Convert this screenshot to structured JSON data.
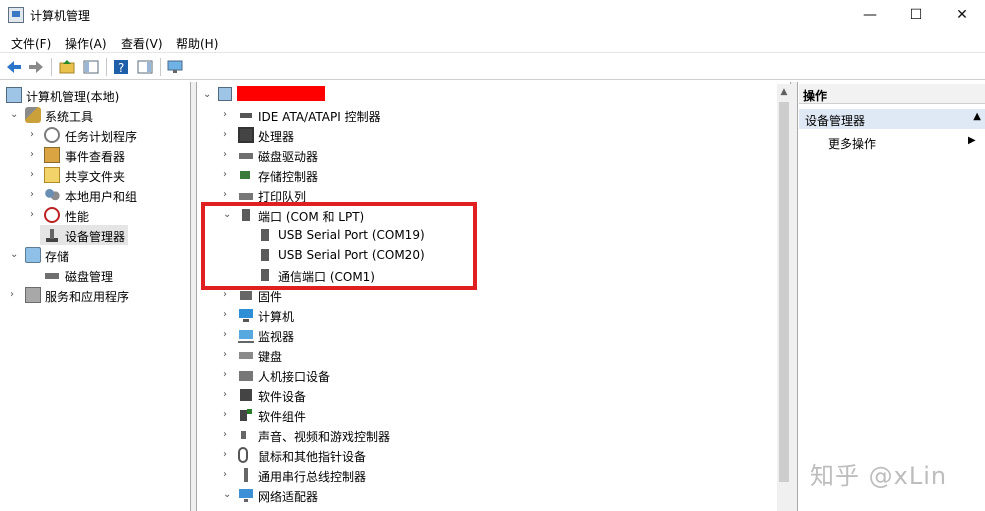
{
  "window": {
    "title": "计算机管理",
    "minimize": "—",
    "maximize": "☐",
    "close": "✕"
  },
  "menubar": {
    "items": [
      {
        "label": "文件(F)"
      },
      {
        "label": "操作(A)"
      },
      {
        "label": "查看(V)"
      },
      {
        "label": "帮助(H)"
      }
    ]
  },
  "toolbar": {
    "back_icon": "back-arrow-icon",
    "forward_icon": "forward-arrow-icon",
    "up_icon": "folder-up-icon",
    "show_hide_icon": "console-tree-icon",
    "help_icon": "help-icon",
    "action_pane_icon": "action-pane-icon",
    "monitor_icon": "monitor-icon"
  },
  "left_tree": {
    "root": "计算机管理(本地)",
    "system_tools": "系统工具",
    "task_scheduler": "任务计划程序",
    "event_viewer": "事件查看器",
    "shared_folders": "共享文件夹",
    "local_users": "本地用户和组",
    "performance": "性能",
    "device_manager": "设备管理器",
    "storage": "存储",
    "disk_management": "磁盘管理",
    "services": "服务和应用程序"
  },
  "device_tree": {
    "categories": [
      {
        "label": "IDE ATA/ATAPI 控制器",
        "icon": "ide-icon"
      },
      {
        "label": "处理器",
        "icon": "cpu-icon"
      },
      {
        "label": "磁盘驱动器",
        "icon": "disk-drive-icon"
      },
      {
        "label": "存储控制器",
        "icon": "storage-controller-icon"
      },
      {
        "label": "打印队列",
        "icon": "printer-icon"
      },
      {
        "label": "端口 (COM 和 LPT)",
        "icon": "port-icon"
      },
      {
        "label": "固件",
        "icon": "firmware-icon"
      },
      {
        "label": "计算机",
        "icon": "computer-icon"
      },
      {
        "label": "监视器",
        "icon": "monitor-icon"
      },
      {
        "label": "键盘",
        "icon": "keyboard-icon"
      },
      {
        "label": "人机接口设备",
        "icon": "hid-icon"
      },
      {
        "label": "软件设备",
        "icon": "software-device-icon"
      },
      {
        "label": "软件组件",
        "icon": "software-component-icon"
      },
      {
        "label": "声音、视频和游戏控制器",
        "icon": "sound-icon"
      },
      {
        "label": "鼠标和其他指针设备",
        "icon": "mouse-icon"
      },
      {
        "label": "通用串行总线控制器",
        "icon": "usb-icon"
      },
      {
        "label": "网络适配器",
        "icon": "network-adapter-icon"
      }
    ],
    "ports": [
      {
        "label": "USB Serial Port (COM19)"
      },
      {
        "label": "USB Serial Port (COM20)"
      },
      {
        "label": "通信端口 (COM1)"
      }
    ]
  },
  "actions_pane": {
    "header": "操作",
    "section": "设备管理器",
    "more": "更多操作"
  },
  "watermark": "知乎 @xLin",
  "colors": {
    "highlight_box": "#e02020",
    "redaction": "#ff0000",
    "section_bg": "#dfe9f5"
  }
}
